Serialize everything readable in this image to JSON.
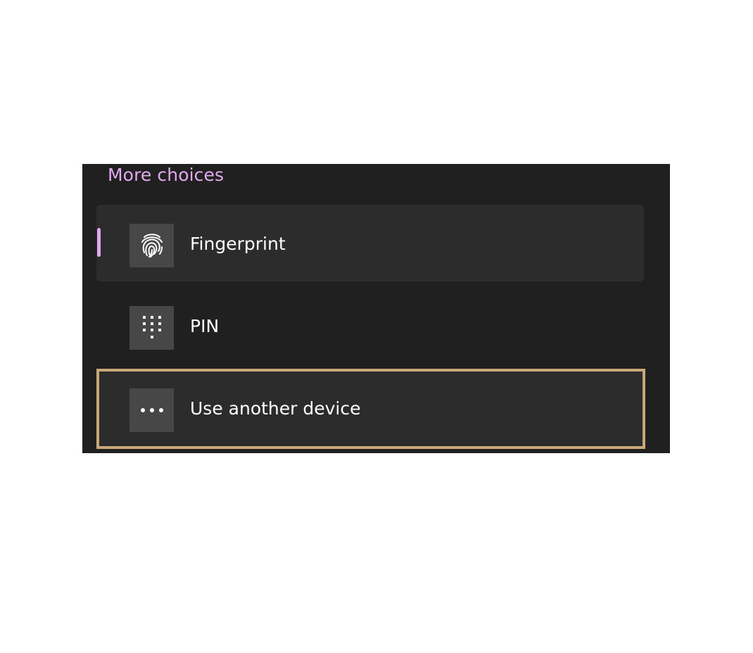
{
  "panel": {
    "heading": "More choices",
    "accent_color": "#e2a9f1",
    "focus_color": "#c8a878",
    "options": [
      {
        "label": "Fingerprint",
        "icon": "fingerprint-icon",
        "state": "selected"
      },
      {
        "label": "PIN",
        "icon": "keypad-icon",
        "state": "normal"
      },
      {
        "label": "Use another device",
        "icon": "more-icon",
        "state": "focused"
      }
    ]
  }
}
